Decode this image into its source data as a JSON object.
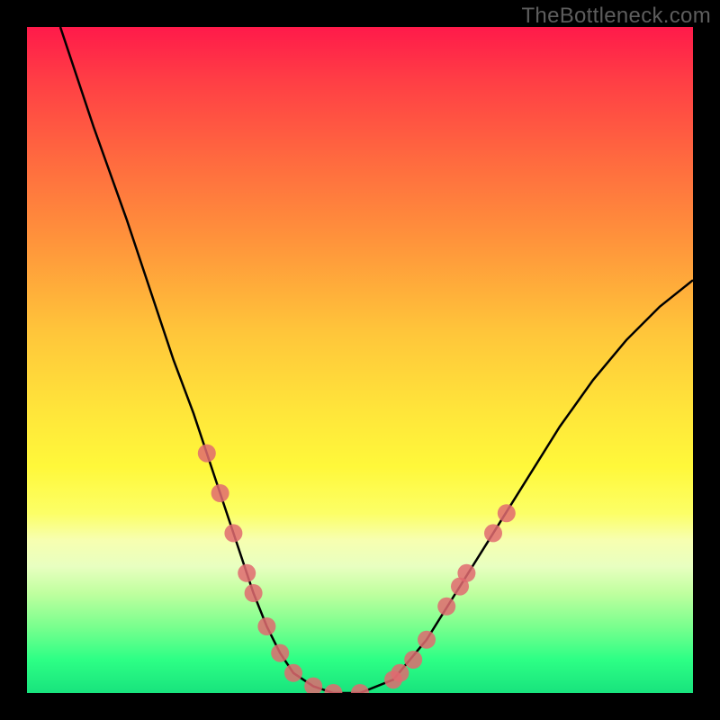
{
  "watermark": "TheBottleneck.com",
  "chart_data": {
    "type": "line",
    "title": "",
    "xlabel": "",
    "ylabel": "",
    "xlim": [
      0,
      100
    ],
    "ylim": [
      0,
      100
    ],
    "series": [
      {
        "name": "bottleneck-curve",
        "x": [
          5,
          10,
          15,
          20,
          22,
          25,
          27,
          29,
          31,
          33,
          34,
          36,
          38,
          40,
          43,
          46,
          50,
          55,
          60,
          65,
          70,
          75,
          80,
          85,
          90,
          95,
          100
        ],
        "values": [
          100,
          85,
          71,
          56,
          50,
          42,
          36,
          30,
          24,
          18,
          15,
          10,
          6,
          3,
          1,
          0,
          0,
          2,
          8,
          16,
          24,
          32,
          40,
          47,
          53,
          58,
          62
        ]
      }
    ],
    "markers": [
      {
        "x": 27,
        "y": 36
      },
      {
        "x": 29,
        "y": 30
      },
      {
        "x": 31,
        "y": 24
      },
      {
        "x": 33,
        "y": 18
      },
      {
        "x": 34,
        "y": 15
      },
      {
        "x": 36,
        "y": 10
      },
      {
        "x": 38,
        "y": 6
      },
      {
        "x": 40,
        "y": 3
      },
      {
        "x": 43,
        "y": 1
      },
      {
        "x": 46,
        "y": 0
      },
      {
        "x": 50,
        "y": 0
      },
      {
        "x": 55,
        "y": 2
      },
      {
        "x": 56,
        "y": 3
      },
      {
        "x": 58,
        "y": 5
      },
      {
        "x": 60,
        "y": 8
      },
      {
        "x": 63,
        "y": 13
      },
      {
        "x": 65,
        "y": 16
      },
      {
        "x": 66,
        "y": 18
      },
      {
        "x": 70,
        "y": 24
      },
      {
        "x": 72,
        "y": 27
      }
    ],
    "colors": {
      "curve": "#000000",
      "marker": "#e06a70"
    }
  }
}
